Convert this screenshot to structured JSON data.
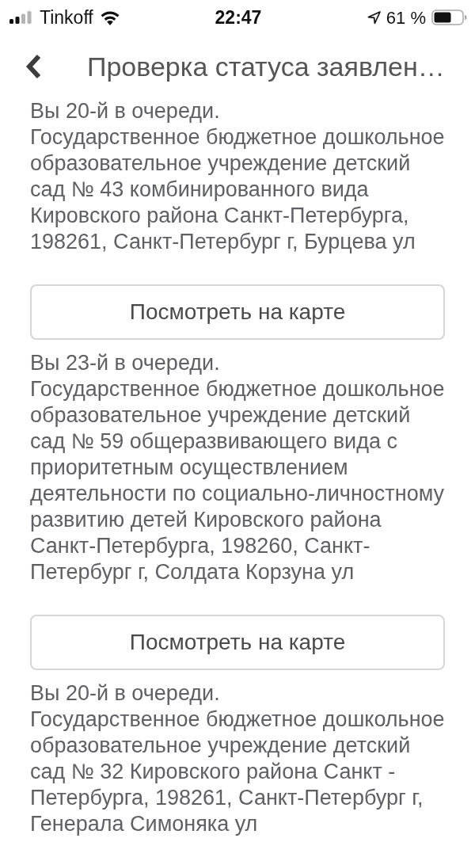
{
  "status_bar": {
    "carrier": "Tinkoff",
    "time": "22:47",
    "battery": "61 %"
  },
  "nav": {
    "title": "Проверка статуса заявлен…"
  },
  "applications": [
    {
      "queue": "Вы 20-й в очереди.",
      "name": "Государственное бюджетное дошкольное образовательное учреждение детский сад № 43 комбинированного вида Кировского района Санкт-Петербурга, 198261, Санкт-Петербург г, Бурцева ул",
      "button": "Посмотреть на карте"
    },
    {
      "queue": "Вы 23-й в очереди.",
      "name": "Государственное бюджетное дошкольное образовательное учреждение детский сад № 59 общеразвивающего вида с приоритетным осуществлением деятельности по социально-личностному развитию детей Кировского района Санкт-Петербурга, 198260, Санкт-Петербург г, Солдата Корзуна ул",
      "button": "Посмотреть на карте"
    },
    {
      "queue": "Вы 20-й в очереди.",
      "name": "Государственное бюджетное дошкольное образовательное учреждение детский сад № 32 Кировского района Санкт - Петербурга, 198261, Санкт-Петербург г, Генерала Симоняка ул"
    }
  ]
}
